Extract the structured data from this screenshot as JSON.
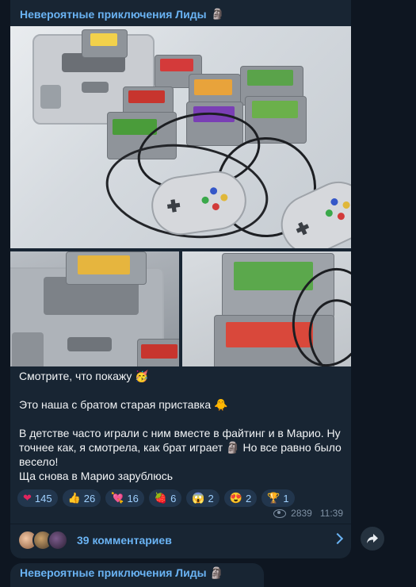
{
  "channel": {
    "name": "Невероятные приключения Лиды",
    "name_icon": "moai-icon"
  },
  "photos": [
    {
      "name": "photo-consoles-and-cartridges"
    },
    {
      "name": "photo-console-closeup"
    },
    {
      "name": "photo-cartridges-closeup"
    }
  ],
  "message": {
    "line1": "Смотрите, что покажу",
    "line2": "Это наша с братом старая приставка",
    "line3a": "В детстве часто играли с ним вместе в файтинг и в Марио. Ну точнее как, я смотрела, как брат играет",
    "line3b": "Но все равно было весело!",
    "line4": "Ща снова в Марио зарублюсь"
  },
  "reactions": [
    {
      "icon": "❤",
      "count": "145",
      "color": "#e0245e"
    },
    {
      "icon": "👍",
      "count": "26",
      "color": "#f5c542"
    },
    {
      "icon": "💘",
      "count": "16",
      "color": "#ff5fa2"
    },
    {
      "icon": "🍓",
      "count": "6",
      "color": "#e33"
    },
    {
      "icon": "😱",
      "count": "2",
      "color": "#8ab4f8"
    },
    {
      "icon": "😍",
      "count": "2",
      "color": "#f5c542"
    },
    {
      "icon": "🏆",
      "count": "1",
      "color": "#f0b429"
    }
  ],
  "meta": {
    "views": "2839",
    "time": "11:39"
  },
  "comments": {
    "label": "39 комментариев"
  },
  "next_post": {
    "channel_name": "Невероятные приключения Лиды"
  }
}
